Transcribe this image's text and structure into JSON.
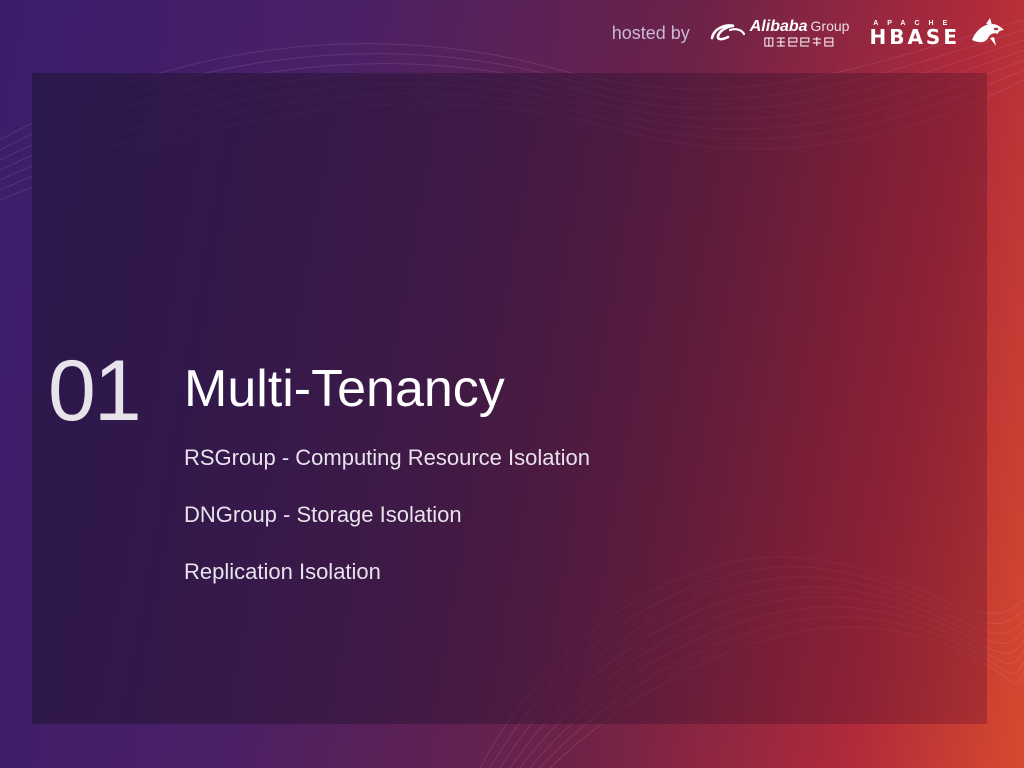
{
  "header": {
    "hosted_by": "hosted by",
    "alibaba": {
      "name": "Alibaba",
      "suffix": "Group",
      "chinese": "阿里巴巴集团",
      "icon": "alibaba-swoosh-icon"
    },
    "hbase": {
      "apache": "APACHE",
      "name": "HBASE",
      "icon": "orca-icon"
    }
  },
  "slide": {
    "number": "01",
    "title": "Multi-Tenancy",
    "bullets": [
      "RSGroup - Computing Resource Isolation",
      "DNGroup - Storage Isolation",
      "Replication Isolation"
    ]
  },
  "colors": {
    "background_left": "#3a1d6b",
    "background_right": "#d84a2e",
    "panel": "#2a1744",
    "text": "#ffffff"
  }
}
